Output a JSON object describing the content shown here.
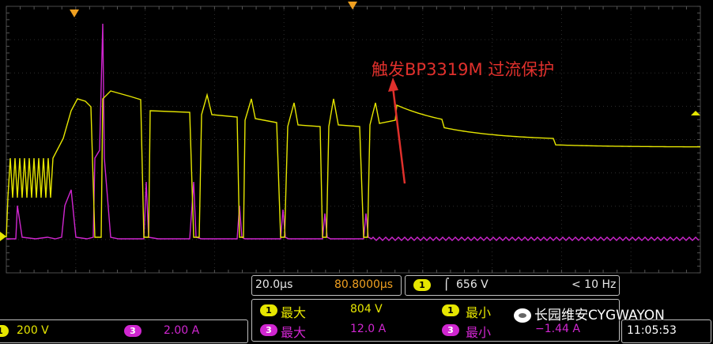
{
  "annotation": "触发BP3319M 过流保护",
  "timebase": {
    "scale": "20.0µs",
    "position": "80.8000µs"
  },
  "trigger": {
    "channel": "1",
    "level": "656 V",
    "freq": "< 10 Hz"
  },
  "measurements": {
    "ch1_max_label": "最大",
    "ch1_max_value": "804 V",
    "ch1_min_label": "最小",
    "ch3_max_label": "最大",
    "ch3_max_value": "12.0 A",
    "ch3_min_label": "最小",
    "ch3_min_value": "−1.44 A"
  },
  "channels": [
    {
      "num": "1",
      "scale": "200 V",
      "color": "#e6e600"
    },
    {
      "num": "3",
      "scale": "2.00 A",
      "color": "#d026d0"
    }
  ],
  "clock": "11:05:53",
  "watermark": "长园维安CYGWAYON",
  "colors": {
    "ch1": "#e6e600",
    "ch3": "#d026d0",
    "grid": "#3a3a3a",
    "annotation": "#e0302c"
  }
}
